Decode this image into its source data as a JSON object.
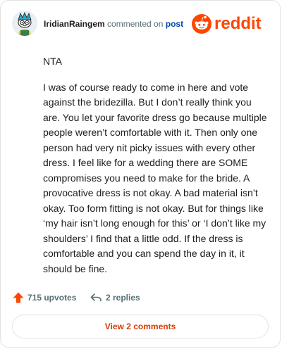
{
  "header": {
    "username": "IridianRaingem",
    "action_text": "commented on",
    "post_link": "post",
    "brand": "reddit"
  },
  "comment": {
    "paragraphs": [
      "NTA",
      "I was of course ready to come in here and vote against the bridezilla. But I don’t really think you are. You let your favorite dress go because multiple people weren’t comfortable with it. Then only one person had very nit picky issues with every other dress. I feel like for a wedding there are SOME compromises you need to make for the bride. A provocative dress is not okay. A bad material isn’t okay. Too form fitting is not okay. But for things like ‘my hair isn’t long enough for this’ or ‘I don’t like my shoulders’ I find that a little odd. If the dress is comfortable and you can spend the day in it, it should be fine."
    ]
  },
  "actions": {
    "upvotes": "715 upvotes",
    "replies": "2 replies"
  },
  "footer": {
    "view_comments": "View 2 comments"
  },
  "colors": {
    "brand": "#ff4500",
    "link": "#0045ac",
    "view_button_text": "#d93a00",
    "muted": "#576f76"
  },
  "icons": [
    "snoo-avatar-icon",
    "reddit-logo-icon",
    "upvote-arrow-icon",
    "reply-arrow-icon"
  ]
}
